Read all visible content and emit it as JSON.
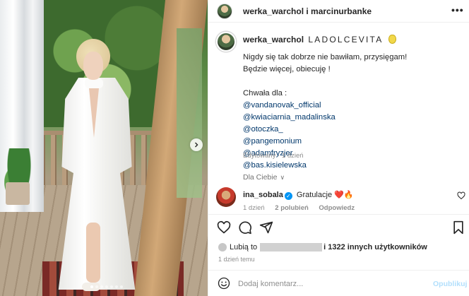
{
  "header": {
    "account_names": "werka_warchol i marcinurbanke",
    "more_glyph": "•••"
  },
  "caption": {
    "author": "werka_warchol",
    "headline": "LADOLCEVITA",
    "lines": [
      "Nigdy się tak dobrze nie bawiłam, przysięgam!",
      "Będzie więcej, obiecuję !",
      "",
      "Chwała dla :"
    ],
    "mentions": [
      "@vandanovak_official",
      "@kwiaciarnia_madalinska",
      "@otoczka_",
      "@pangemonium",
      "@adamfryzjer",
      "@bas.kisielewska"
    ],
    "meta": "Edytowany · 1 dzień"
  },
  "replies_toggle": {
    "label": "Dla Ciebie",
    "chevron": "∨"
  },
  "comment": {
    "user": "ina_sobala",
    "verified_glyph": "✓",
    "text": "Gratulacje ❤️🔥",
    "time": "1 dzień",
    "likes": "2 polubień",
    "reply": "Odpowiedz"
  },
  "likes": {
    "prefix": "Lubią to",
    "suffix": "i 1322 innych użytkowników"
  },
  "post_time": "1 dzień temu",
  "comment_box": {
    "placeholder": "Dodaj komentarz...",
    "post_label": "Opublikuj"
  },
  "carousel": {
    "dot_count": 7,
    "active_dot": 0
  }
}
